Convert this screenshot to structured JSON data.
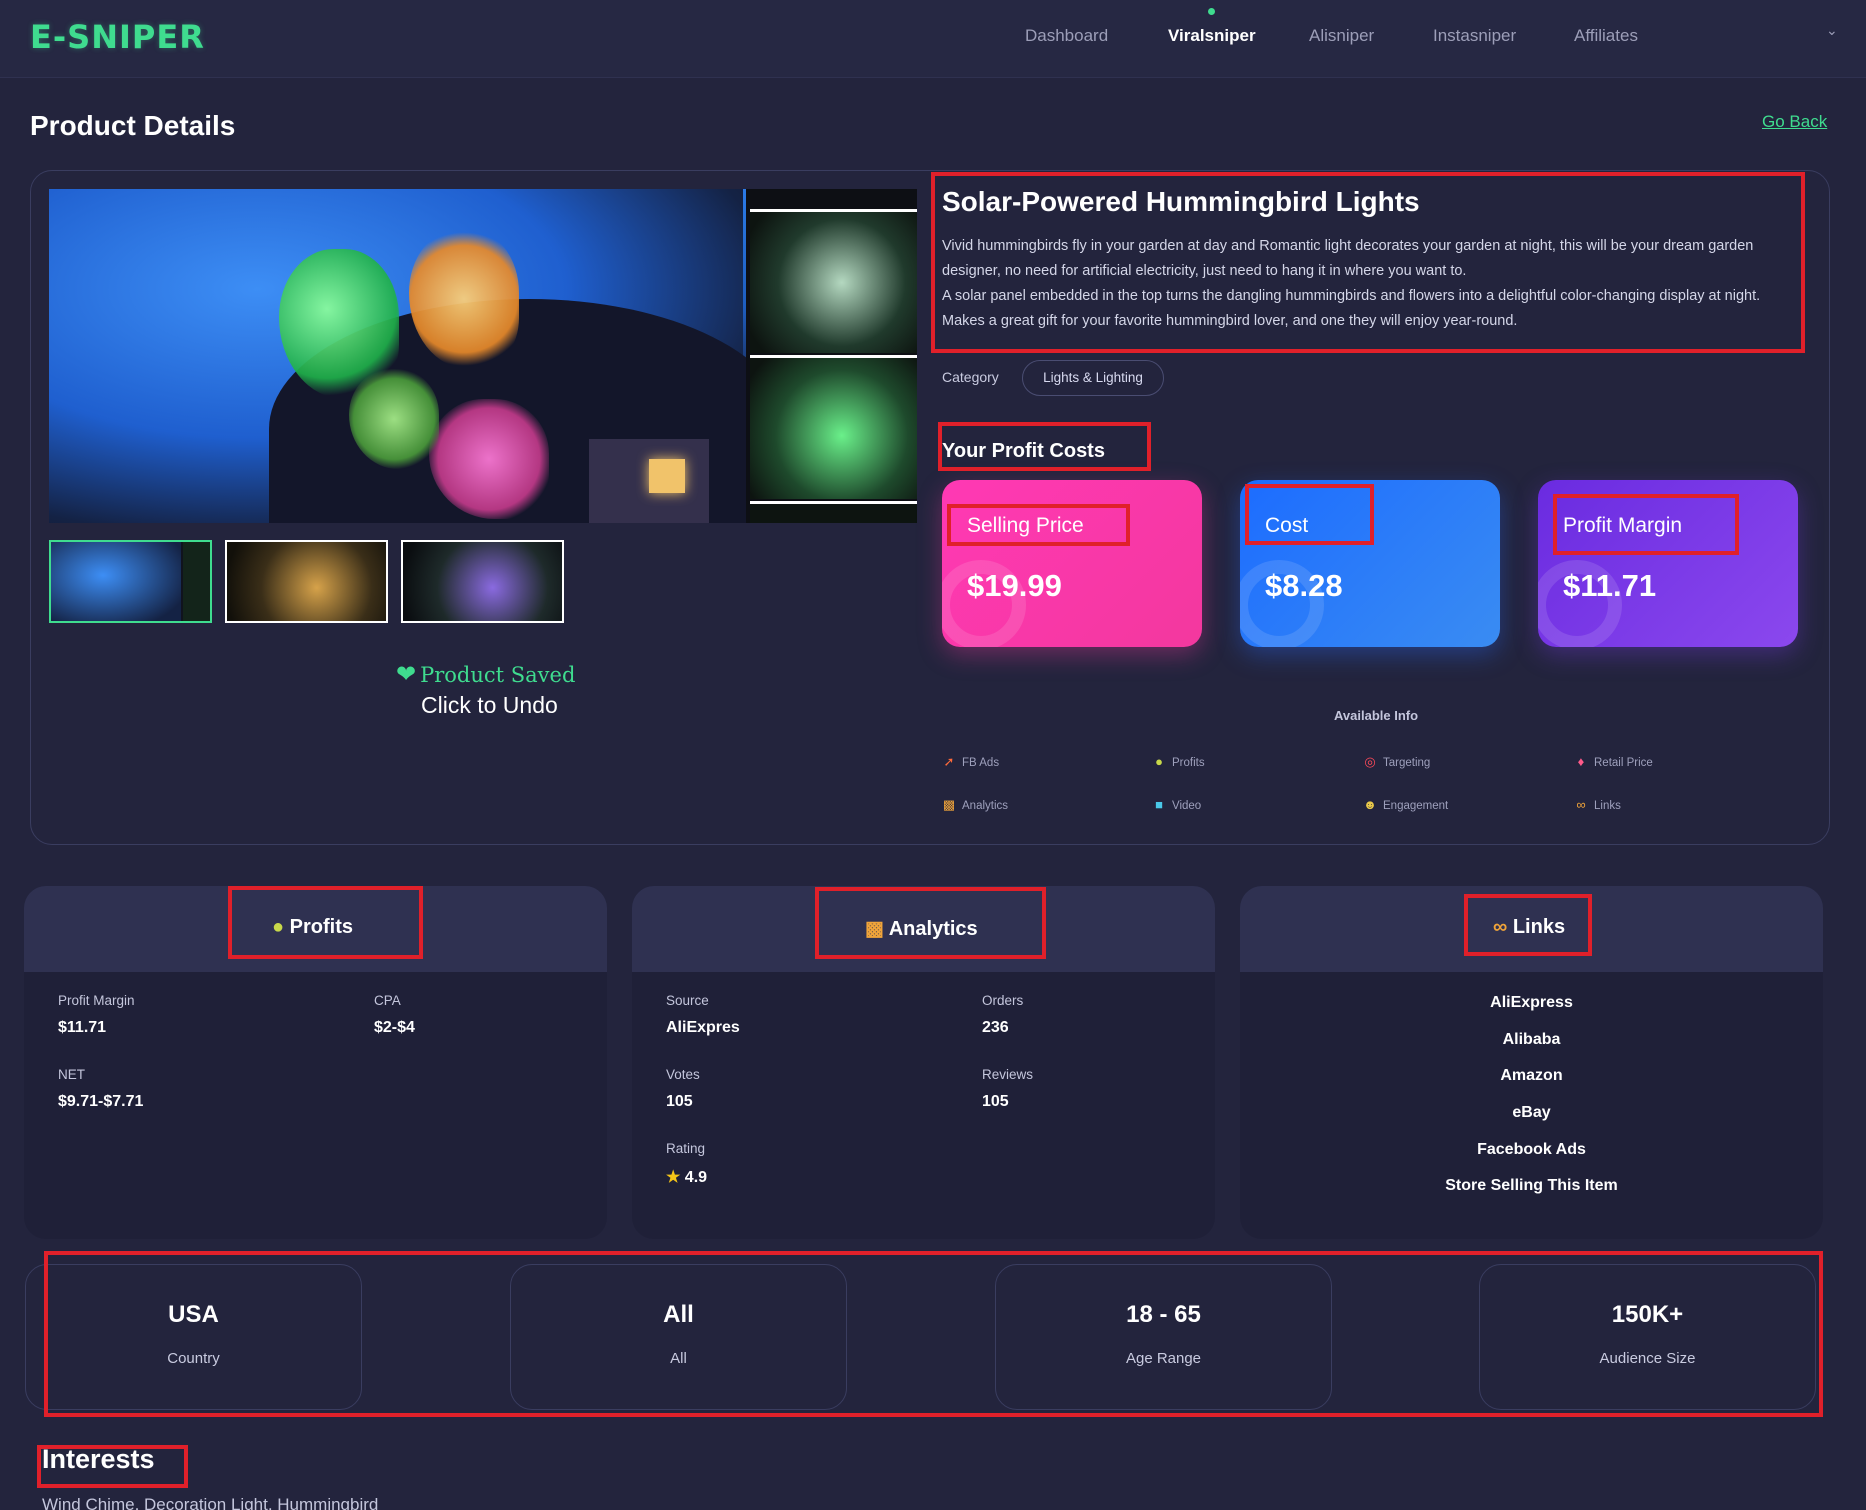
{
  "header": {
    "logo": "E-SNIPER",
    "nav": [
      "Dashboard",
      "Viralsniper",
      "Alisniper",
      "Instasniper",
      "Affiliates"
    ],
    "active_nav": "Viralsniper"
  },
  "page": {
    "title": "Product Details",
    "go_back": "Go Back"
  },
  "product": {
    "title": "Solar-Powered Hummingbird Lights",
    "description_1": "Vivid hummingbirds fly in your garden at day and Romantic light decorates your garden at night, this will be your dream garden designer, no need for artificial electricity, just need to hang it in where you want to.",
    "description_2": "A solar panel embedded in the top turns the dangling hummingbirds and flowers into a delightful color-changing display at night. Makes a great gift for your favorite hummingbird lover, and one they will enjoy year-round.",
    "category_label": "Category",
    "category": "Lights & Lighting",
    "saved_text": "Product Saved",
    "undo_text": "Click to Undo"
  },
  "profit_costs": {
    "heading": "Your Profit Costs",
    "cards": [
      {
        "label": "Selling Price",
        "value": "$19.99"
      },
      {
        "label": "Cost",
        "value": "$8.28"
      },
      {
        "label": "Profit Margin",
        "value": "$11.71"
      }
    ]
  },
  "available_info": {
    "title": "Available Info",
    "items": [
      {
        "label": "FB Ads",
        "icon": "rocket-icon"
      },
      {
        "label": "Profits",
        "icon": "money-bag-icon"
      },
      {
        "label": "Targeting",
        "icon": "target-icon"
      },
      {
        "label": "Retail Price",
        "icon": "price-tag-icon"
      },
      {
        "label": "Analytics",
        "icon": "bar-chart-icon"
      },
      {
        "label": "Video",
        "icon": "video-camera-icon"
      },
      {
        "label": "Engagement",
        "icon": "people-icon"
      },
      {
        "label": "Links",
        "icon": "link-icon"
      }
    ]
  },
  "profits": {
    "title": "Profits",
    "profit_margin_label": "Profit Margin",
    "profit_margin": "$11.71",
    "cpa_label": "CPA",
    "cpa": "$2-$4",
    "net_label": "NET",
    "net": "$9.71-$7.71"
  },
  "analytics": {
    "title": "Analytics",
    "source_label": "Source",
    "source": "AliExpres",
    "orders_label": "Orders",
    "orders": "236",
    "votes_label": "Votes",
    "votes": "105",
    "reviews_label": "Reviews",
    "reviews": "105",
    "rating_label": "Rating",
    "rating": "4.9"
  },
  "links": {
    "title": "Links",
    "items": [
      "AliExpress",
      "Alibaba",
      "Amazon",
      "eBay",
      "Facebook Ads",
      "Store Selling This Item"
    ]
  },
  "targeting": [
    {
      "value": "USA",
      "label": "Country"
    },
    {
      "value": "All",
      "label": "All"
    },
    {
      "value": "18 - 65",
      "label": "Age Range"
    },
    {
      "value": "150K+",
      "label": "Audience Size"
    }
  ],
  "interests": {
    "title": "Interests",
    "text": "Wind Chime, Decoration Light, Hummingbird"
  },
  "colors": {
    "accent_green": "#3fdc8f",
    "selling_pink": "#f3389e",
    "cost_blue": "#1c6cff",
    "margin_purple": "#7a3ae8",
    "annotation_red": "#e0202a"
  }
}
